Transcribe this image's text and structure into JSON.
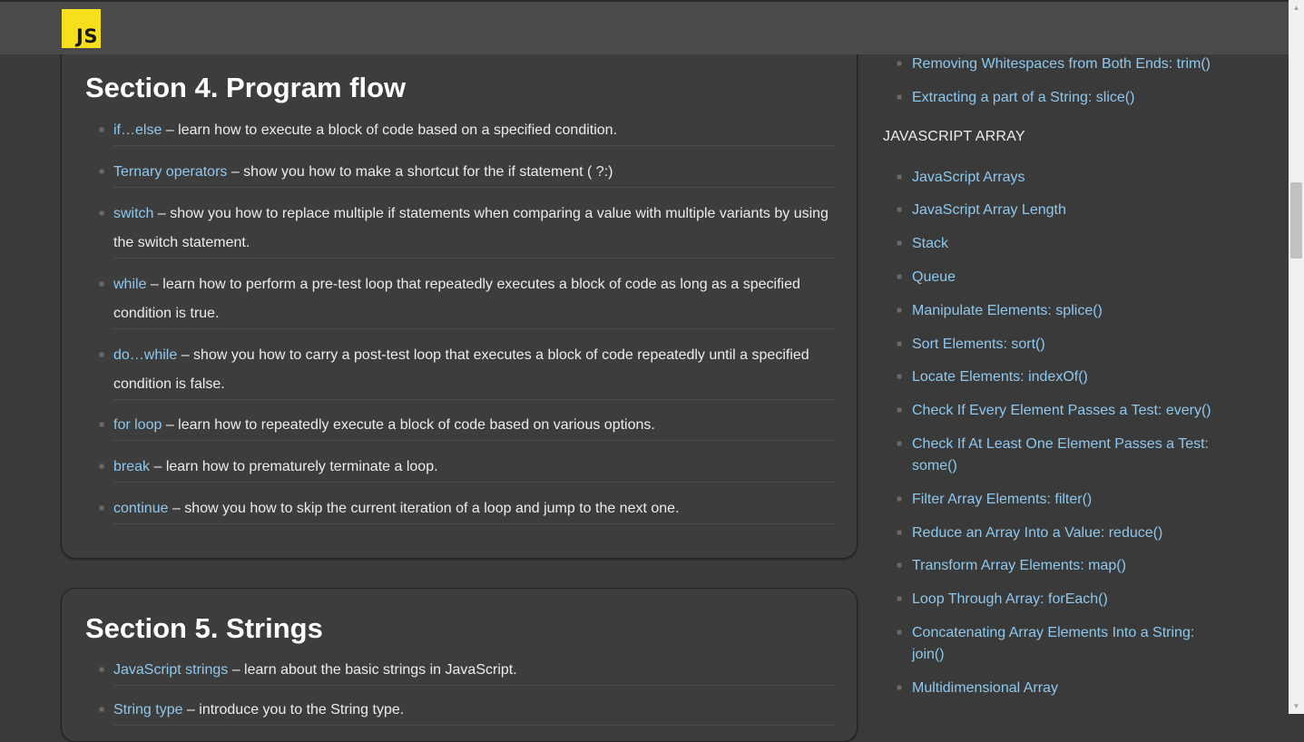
{
  "header": {
    "logo_text": "JS"
  },
  "section4": {
    "title": "Section 4. Program flow",
    "items": [
      {
        "link": "if…else",
        "desc": " – learn how to execute a block of code based on a specified condition."
      },
      {
        "link": "Ternary operators",
        "desc": " – show you how to make a shortcut for the if statement ( ?:)"
      },
      {
        "link": "switch",
        "desc": " – show you how to replace multiple if statements when comparing a value with multiple variants by using the switch statement."
      },
      {
        "link": "while",
        "desc": " – learn how to perform a pre-test loop that repeatedly executes a block of code as long as a specified condition is true."
      },
      {
        "link": "do…while",
        "desc": " – show you how to carry a post-test loop that executes a block of code repeatedly until a specified condition is false."
      },
      {
        "link": "for loop",
        "desc": " – learn how to repeatedly execute a block of code based on various options."
      },
      {
        "link": "break",
        "desc": " – learn how to prematurely terminate a loop."
      },
      {
        "link": "continue",
        "desc": " – show you how to skip the current iteration of a loop and jump to the next one."
      }
    ]
  },
  "section5": {
    "title": "Section 5. Strings",
    "items": [
      {
        "link": "JavaScript strings",
        "desc": " – learn about the basic strings in JavaScript."
      },
      {
        "link": "String type",
        "desc": " – introduce you to the String type."
      }
    ]
  },
  "sidebar": {
    "string_links": [
      "Removing Whitespaces from Both Ends: trim()",
      "Extracting a part of a String: slice()"
    ],
    "array_heading": "JAVASCRIPT ARRAY",
    "array_links": [
      "JavaScript Arrays",
      "JavaScript Array Length",
      "Stack",
      "Queue",
      "Manipulate Elements: splice()",
      "Sort Elements: sort()",
      "Locate Elements: indexOf()",
      "Check If Every Element Passes a Test: every()",
      "Check If At Least One Element Passes a Test: some()",
      "Filter Array Elements: filter()",
      "Reduce an Array Into a Value: reduce()",
      "Transform Array Elements: map()",
      "Loop Through Array: forEach()",
      "Concatenating Array Elements Into a String: join()",
      "Multidimensional Array"
    ]
  }
}
